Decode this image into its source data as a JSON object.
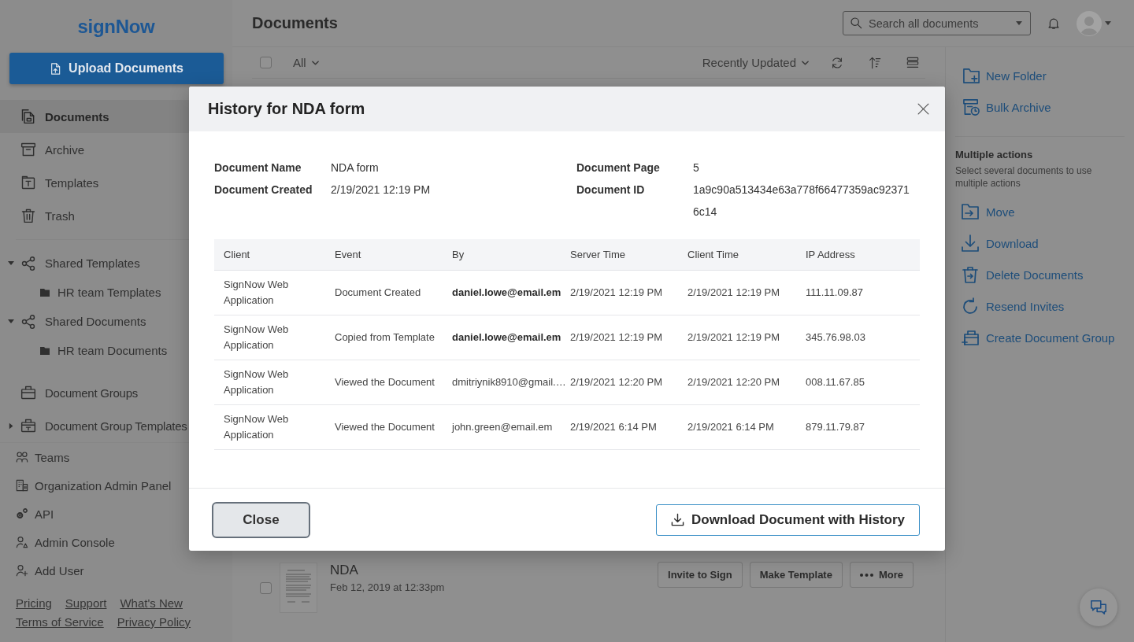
{
  "sidebar": {
    "logo": "signNow",
    "upload_button": "Upload Documents",
    "nav": [
      {
        "label": "Documents",
        "selected": true
      },
      {
        "label": "Archive",
        "selected": false
      },
      {
        "label": "Templates",
        "selected": false
      },
      {
        "label": "Trash",
        "selected": false
      }
    ],
    "shared": [
      {
        "label": "Shared Templates",
        "expanded": true,
        "children": [
          {
            "label": "HR team Templates"
          }
        ]
      },
      {
        "label": "Shared Documents",
        "expanded": true,
        "children": [
          {
            "label": "HR team Documents"
          }
        ]
      }
    ],
    "groups": [
      {
        "label": "Document Groups"
      },
      {
        "label": "Document Group Templates",
        "expanded": false
      }
    ],
    "admin": [
      "Teams",
      "Organization Admin Panel",
      "API",
      "Admin Console",
      "Add User"
    ],
    "footer_links": [
      [
        "Pricing",
        "Support",
        "What's New"
      ],
      [
        "Terms of Service",
        "Privacy Policy"
      ]
    ]
  },
  "header": {
    "title": "Documents",
    "search": {
      "placeholder": "Search all documents"
    }
  },
  "toolbar": {
    "select_all": {
      "checked": false
    },
    "filter": "All",
    "sort": "Recently Updated"
  },
  "documents": [
    {
      "name": "NDA",
      "date": "Feb 12, 2019 at 12:33pm",
      "checked": false,
      "actions": [
        {
          "label": "Invite to Sign",
          "kind": "plain"
        },
        {
          "label": "Make Template",
          "kind": "plain"
        },
        {
          "label": "More",
          "kind": "menu"
        }
      ]
    }
  ],
  "actions_panel": {
    "items": [
      "New Folder",
      "Bulk Archive"
    ],
    "multiple_actions": {
      "title": "Multiple actions",
      "description": "Select several documents to use multiple actions",
      "items": [
        "Move",
        "Download",
        "Delete Documents",
        "Resend Invites",
        "Create Document Group"
      ]
    }
  },
  "history_dialog": {
    "title": "History for NDA form",
    "details": [
      {
        "label": "Document Name",
        "value": "NDA form"
      },
      {
        "label": "Document Page",
        "value": "5"
      },
      {
        "label": "Document Created",
        "value": "2/19/2021 12:19 PM"
      },
      {
        "label": "Document ID",
        "value": "1a9c90a513434e63a778f66477359ac923716c14"
      }
    ],
    "table": {
      "columns": [
        "Client",
        "Event",
        "By",
        "Server Time",
        "Client Time",
        "IP Address"
      ],
      "rows": [
        {
          "cells": [
            "SignNow Web Application",
            "Document Created",
            "daniel.lowe@email.em",
            "2/19/2021 12:19 PM",
            "2/19/2021 12:19 PM",
            "111.11.09.87"
          ],
          "by_emphasized": true
        },
        {
          "cells": [
            "SignNow Web Application",
            "Copied from Template",
            "daniel.lowe@email.em",
            "2/19/2021 12:19 PM",
            "2/19/2021 12:19 PM",
            "345.76.98.03"
          ],
          "by_emphasized": true
        },
        {
          "cells": [
            "SignNow Web Application",
            "Viewed the Document",
            "dmitriynik8910@gmail.…",
            "2/19/2021 12:20 PM",
            "2/19/2021 12:20 PM",
            "008.11.67.85"
          ],
          "by_emphasized": false
        },
        {
          "cells": [
            "SignNow Web Application",
            "Viewed the Document",
            "john.green@email.em",
            "2/19/2021 6:14 PM",
            "2/19/2021 6:14 PM",
            "879.11.79.87"
          ],
          "by_emphasized": false
        }
      ]
    },
    "close_button": "Close",
    "download_button": "Download Document with History"
  }
}
